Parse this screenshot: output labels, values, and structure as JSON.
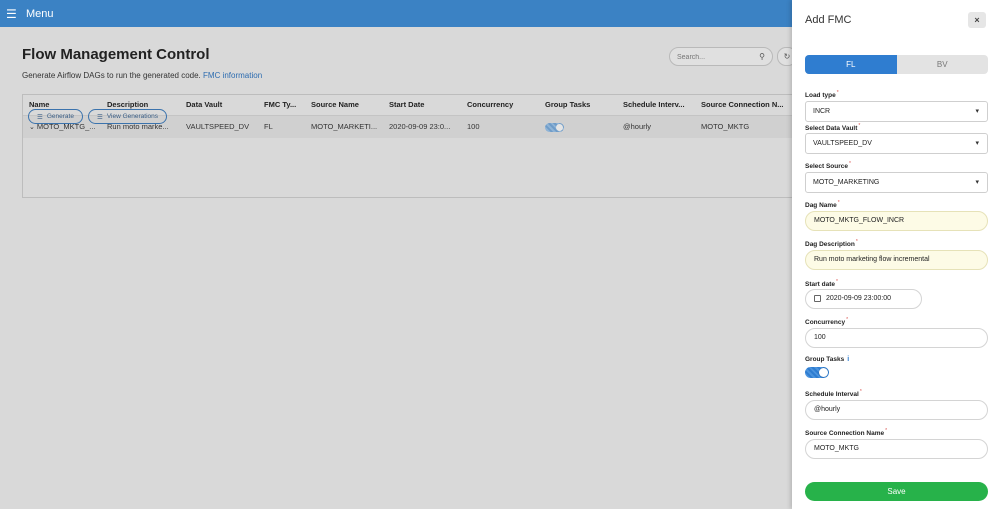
{
  "topbar": {
    "menu_label": "Menu",
    "menu_icon": "hamburger-icon"
  },
  "main": {
    "title": "Flow Management Control",
    "subtitle_text": "Generate Airflow DAGs to run the generated code.",
    "subtitle_link": "FMC information",
    "search_placeholder": "Search...",
    "table": {
      "headers": [
        "Name",
        "Description",
        "Data Vault",
        "FMC Ty...",
        "Source Name",
        "Start Date",
        "Concurrency",
        "Group Tasks",
        "Schedule Interv...",
        "Source Connection N..."
      ],
      "rows": [
        [
          "MOTO_MKTG_...",
          "Run moto marke...",
          "VAULTSPEED_DV",
          "FL",
          "MOTO_MARKETI...",
          "2020-09-09 23:0...",
          "100",
          "",
          "@hourly",
          "MOTO_MKTG"
        ]
      ]
    },
    "generate_label": "Generate",
    "view_generations_label": "View Generations"
  },
  "panel": {
    "title": "Add FMC",
    "close_label": "×",
    "tabs": {
      "fl": "FL",
      "bv": "BV",
      "active": "FL"
    },
    "load_type": {
      "label": "Load type",
      "value": "INCR"
    },
    "data_vault": {
      "label": "Select Data Vault",
      "value": "VAULTSPEED_DV"
    },
    "source": {
      "label": "Select Source",
      "value": "MOTO_MARKETING"
    },
    "dag_name": {
      "label": "Dag Name",
      "value": "MOTO_MKTG_FLOW_INCR"
    },
    "dag_description": {
      "label": "Dag Description",
      "value": "Run moto marketing flow incremental"
    },
    "start_date": {
      "label": "Start date",
      "value": "2020-09-09 23:00:00"
    },
    "concurrency": {
      "label": "Concurrency",
      "value": "100"
    },
    "group_tasks": {
      "label": "Group Tasks",
      "info": "i"
    },
    "schedule_interval": {
      "label": "Schedule Interval",
      "value": "@hourly"
    },
    "source_connection": {
      "label": "Source Connection Name",
      "value": "MOTO_MKTG"
    },
    "save_label": "Save"
  },
  "colors": {
    "topbar": "#3b82c4",
    "accent": "#2f7dd0",
    "save": "#27b24a"
  }
}
